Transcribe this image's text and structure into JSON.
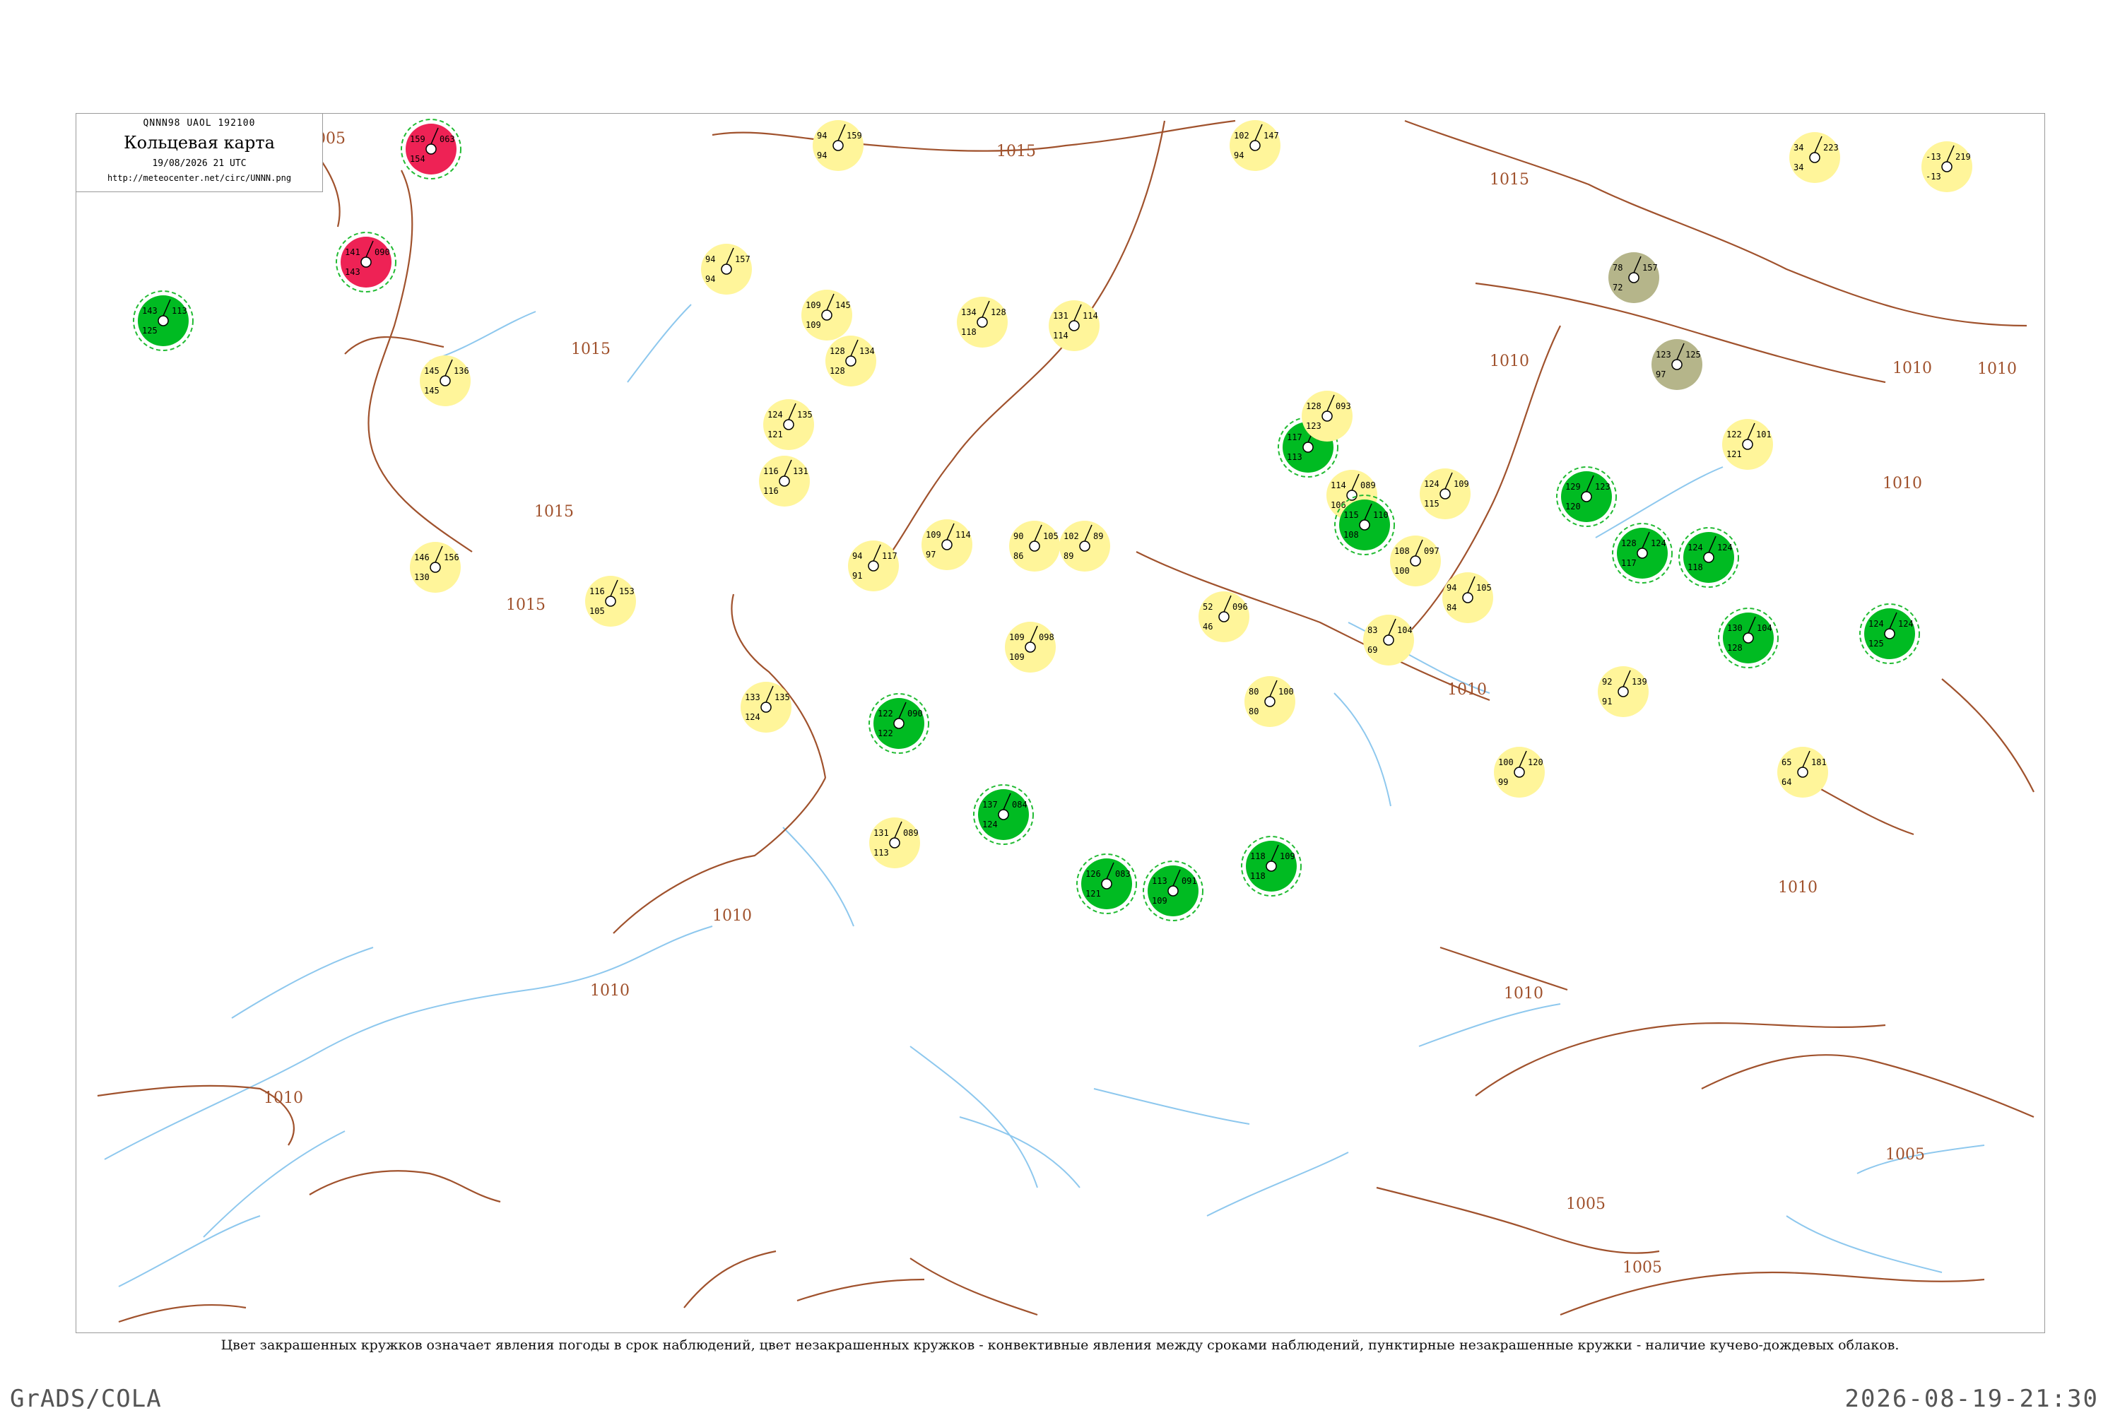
{
  "header": {
    "code_line": "QNNN98  UAOL  192100",
    "title": "Кольцевая карта",
    "date": "19/08/2026 21 UTC",
    "url": "http://meteocenter.net/circ/UNNN.png"
  },
  "caption": "Цвет закрашенных кружков означает явления погоды в срок наблюдений, цвет незакрашенных кружков - конвективные явления между сроками наблюдений, пунктирные незакрашенные кружки - наличие кучево-дождевых облаков.",
  "footer": {
    "left": "GrADS/COLA",
    "right": "2026-08-19-21:30"
  },
  "colors": {
    "isobar": "#a0522d",
    "river": "#8ec8ee",
    "rain_fill": "#00bb22",
    "yellow_fill": "#fff59a",
    "thunder_fill": "#ee2255",
    "olive_fill": "#b5b58a",
    "cb_dashed": "#22bb33"
  },
  "isobar_labels": [
    "1005",
    "1010",
    "1015"
  ],
  "stations": [
    {
      "id": "s1",
      "fill": "red",
      "v": [
        "159",
        "063",
        "154"
      ]
    },
    {
      "id": "s2",
      "fill": "red",
      "v": [
        "141",
        "090",
        "143"
      ]
    },
    {
      "id": "s3",
      "fill": "green",
      "v": [
        "143",
        "113",
        "125"
      ]
    },
    {
      "id": "s4",
      "fill": "yellow",
      "v": [
        "94",
        "159",
        "94"
      ]
    },
    {
      "id": "s5",
      "fill": "yellow",
      "v": [
        "94",
        "157",
        "94"
      ]
    },
    {
      "id": "s6",
      "fill": "yellow",
      "v": [
        "109",
        "145",
        "109"
      ]
    },
    {
      "id": "s7",
      "fill": "yellow",
      "v": [
        "128",
        "134",
        "128"
      ]
    },
    {
      "id": "s8",
      "fill": "yellow",
      "v": [
        "134",
        "128",
        "118"
      ]
    },
    {
      "id": "s9",
      "fill": "yellow",
      "v": [
        "131",
        "114",
        "114"
      ]
    },
    {
      "id": "s10",
      "fill": "yellow",
      "v": [
        "102",
        "147",
        "94"
      ]
    },
    {
      "id": "s11",
      "fill": "yellow",
      "v": [
        "34",
        "223",
        "34"
      ]
    },
    {
      "id": "s12",
      "fill": "yellow",
      "v": [
        "-13",
        "219",
        "-13"
      ]
    },
    {
      "id": "s13",
      "fill": "olive",
      "v": [
        "78",
        "157",
        "72"
      ]
    },
    {
      "id": "s14",
      "fill": "olive",
      "v": [
        "123",
        "125",
        "97"
      ]
    },
    {
      "id": "s15",
      "fill": "yellow",
      "v": [
        "145",
        "136",
        "145"
      ]
    },
    {
      "id": "s16",
      "fill": "yellow",
      "v": [
        "124",
        "135",
        "121"
      ]
    },
    {
      "id": "s17",
      "fill": "yellow",
      "v": [
        "116",
        "131",
        "116"
      ]
    },
    {
      "id": "s18",
      "fill": "yellow",
      "v": [
        "146",
        "156",
        "130"
      ]
    },
    {
      "id": "s19",
      "fill": "yellow",
      "v": [
        "116",
        "153",
        "105"
      ]
    },
    {
      "id": "s20",
      "fill": "yellow",
      "v": [
        "133",
        "135",
        "124"
      ]
    },
    {
      "id": "s21",
      "fill": "yellow",
      "v": [
        "109",
        "114",
        "97"
      ]
    },
    {
      "id": "s22",
      "fill": "yellow",
      "v": [
        "94",
        "117",
        "91"
      ]
    },
    {
      "id": "s23",
      "fill": "yellow",
      "v": [
        "90",
        "105",
        "86"
      ]
    },
    {
      "id": "s24",
      "fill": "yellow",
      "v": [
        "102",
        "89",
        "89"
      ]
    },
    {
      "id": "s25",
      "fill": "yellow",
      "v": [
        "109",
        "098",
        "109"
      ]
    },
    {
      "id": "s26",
      "fill": "yellow",
      "v": [
        "131",
        "089",
        "113"
      ]
    },
    {
      "id": "s27",
      "fill": "green",
      "v": [
        "122",
        "090",
        "122"
      ]
    },
    {
      "id": "s28",
      "fill": "green",
      "v": [
        "137",
        "084",
        "124"
      ]
    },
    {
      "id": "s29",
      "fill": "green",
      "v": [
        "126",
        "083",
        "121"
      ]
    },
    {
      "id": "s30",
      "fill": "green",
      "v": [
        "113",
        "091",
        "109"
      ]
    },
    {
      "id": "s31",
      "fill": "green",
      "v": [
        "118",
        "109",
        "118"
      ]
    },
    {
      "id": "s32",
      "fill": "green",
      "v": [
        "117",
        "114",
        "113"
      ]
    },
    {
      "id": "s33",
      "fill": "yellow",
      "v": [
        "114",
        "089",
        "106"
      ]
    },
    {
      "id": "s34",
      "fill": "yellow",
      "v": [
        "128",
        "093",
        "123"
      ]
    },
    {
      "id": "s35",
      "fill": "yellow",
      "v": [
        "108",
        "097",
        "100"
      ]
    },
    {
      "id": "s36",
      "fill": "yellow",
      "v": [
        "124",
        "109",
        "115"
      ]
    },
    {
      "id": "s37",
      "fill": "yellow",
      "v": [
        "94",
        "105",
        "84"
      ]
    },
    {
      "id": "s38",
      "fill": "yellow",
      "v": [
        "83",
        "104",
        "69"
      ]
    },
    {
      "id": "s39",
      "fill": "yellow",
      "v": [
        "52",
        "096",
        "46"
      ]
    },
    {
      "id": "s40",
      "fill": "yellow",
      "v": [
        "80",
        "100",
        "80"
      ]
    },
    {
      "id": "s41",
      "fill": "yellow",
      "v": [
        "92",
        "139",
        "91"
      ]
    },
    {
      "id": "s42",
      "fill": "yellow",
      "v": [
        "100",
        "120",
        "99"
      ]
    },
    {
      "id": "s43",
      "fill": "yellow",
      "v": [
        "65",
        "181",
        "64"
      ]
    },
    {
      "id": "s44",
      "fill": "yellow",
      "v": [
        "122",
        "101",
        "121"
      ]
    },
    {
      "id": "s45",
      "fill": "green",
      "v": [
        "115",
        "110",
        "108"
      ]
    },
    {
      "id": "s46",
      "fill": "green",
      "v": [
        "129",
        "123",
        "120"
      ]
    },
    {
      "id": "s47",
      "fill": "green",
      "v": [
        "128",
        "124",
        "117"
      ]
    },
    {
      "id": "s48",
      "fill": "green",
      "v": [
        "124",
        "124",
        "118"
      ]
    },
    {
      "id": "s49",
      "fill": "green",
      "v": [
        "130",
        "104",
        "128"
      ]
    },
    {
      "id": "s50",
      "fill": "green",
      "v": [
        "124",
        "124",
        "125"
      ]
    }
  ]
}
